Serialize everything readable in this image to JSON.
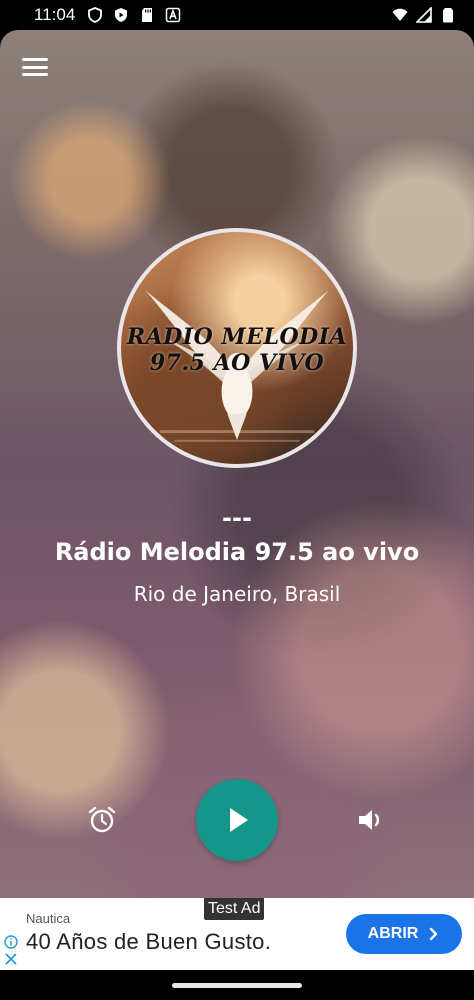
{
  "status_bar": {
    "time": "11:04",
    "left_icons": [
      "shield-icon",
      "play-protect-icon",
      "sd-card-icon",
      "text-icon"
    ],
    "right_icons": [
      "wifi-icon",
      "signal-icon",
      "battery-icon"
    ]
  },
  "app": {
    "menu_icon": "hamburger-menu-icon",
    "logo": {
      "line1": "RADIO MELODIA",
      "line2": "97.5 AO VIVO"
    },
    "now_playing": {
      "track": "---",
      "station_name": "Rádio Melodia 97.5 ao vivo",
      "location": "Rio de Janeiro, Brasil"
    },
    "controls": {
      "alarm_icon": "alarm-clock-icon",
      "play_icon": "play-icon",
      "volume_icon": "volume-icon",
      "play_color": "#15968a"
    }
  },
  "ad": {
    "label": "Test Ad",
    "brand": "Nautica",
    "headline": "40 Años de Buen Gusto.",
    "cta": "ABRIR",
    "cta_color": "#1a73e8"
  }
}
